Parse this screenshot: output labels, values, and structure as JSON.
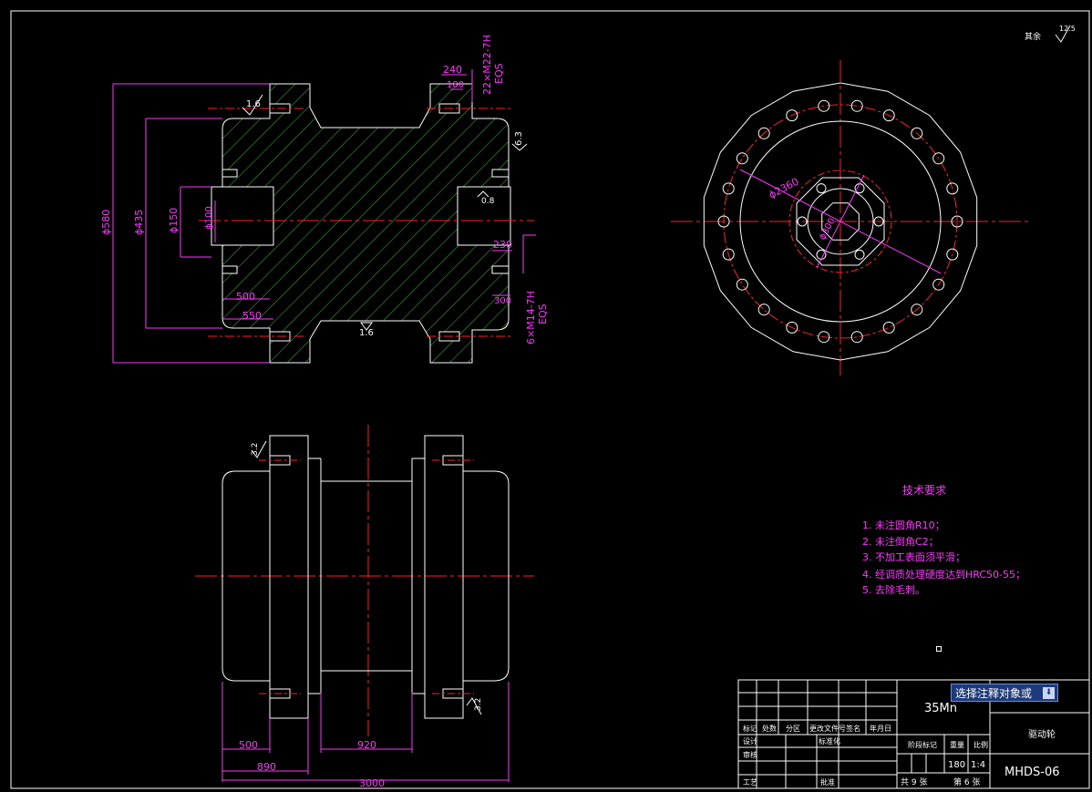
{
  "drawing": {
    "roughness_note": "其余",
    "roughness_value": "12.5",
    "front_view": {
      "dims": {
        "d580": "ϕ580",
        "d435": "ϕ435",
        "d150": "ϕ150",
        "d100": "ϕ100",
        "l500": "500",
        "l550": "550",
        "l240": "240",
        "l180": "180",
        "l230": "230",
        "l300": "300",
        "thread_top": "22×M22-7H",
        "thread_top_eqs": "EQS",
        "thread_bottom": "6×M14-7H",
        "thread_bottom_eqs": "EQS",
        "r16_top": "1.6",
        "r16_bottom": "1.6",
        "r63": "6.3",
        "r08": "0.8"
      }
    },
    "side_view": {
      "dims": {
        "d2360": "ϕ2360",
        "d300": "ϕ300"
      }
    },
    "bottom_view": {
      "dims": {
        "l500": "500",
        "l890": "890",
        "l920": "920",
        "l3000": "3000",
        "r32_top": "3.2",
        "r32_bottom": "3.2"
      }
    },
    "tech_requirements": {
      "title": "技术要求",
      "items": [
        "1. 未注圆角R10；",
        "2. 未注倒角C2；",
        "3. 不加工表面须平滑；",
        "4. 经调质处理硬度达到HRC50-55；",
        "5. 去除毛刺。"
      ]
    }
  },
  "title_block": {
    "material": "35Mn",
    "part_name": "驱动轮",
    "drawing_no": "MHDS-06",
    "weight": "180",
    "scale": "1:4",
    "sheets_total": "共 9 张",
    "sheet_no": "第 6 张",
    "labels": {
      "mark": "标记",
      "count": "处数",
      "zone": "分区",
      "change_doc": "更改文件号",
      "sign": "签名",
      "date": "年月日",
      "design": "设计",
      "check": "审核",
      "process": "工艺",
      "standard": "标准化",
      "approve": "批准",
      "stage_mark": "阶段标记",
      "weight_label": "重量",
      "scale_label": "比例"
    }
  },
  "ui": {
    "dropdown_text": "选择注释对象或",
    "dropdown_arrow": "⬇"
  },
  "colors": {
    "background": "#000000",
    "outline": "#ffffff",
    "dimension": "#ff33ff",
    "center": "#ff2020",
    "hatch": "#30c030",
    "leader": "#30e0e0"
  }
}
